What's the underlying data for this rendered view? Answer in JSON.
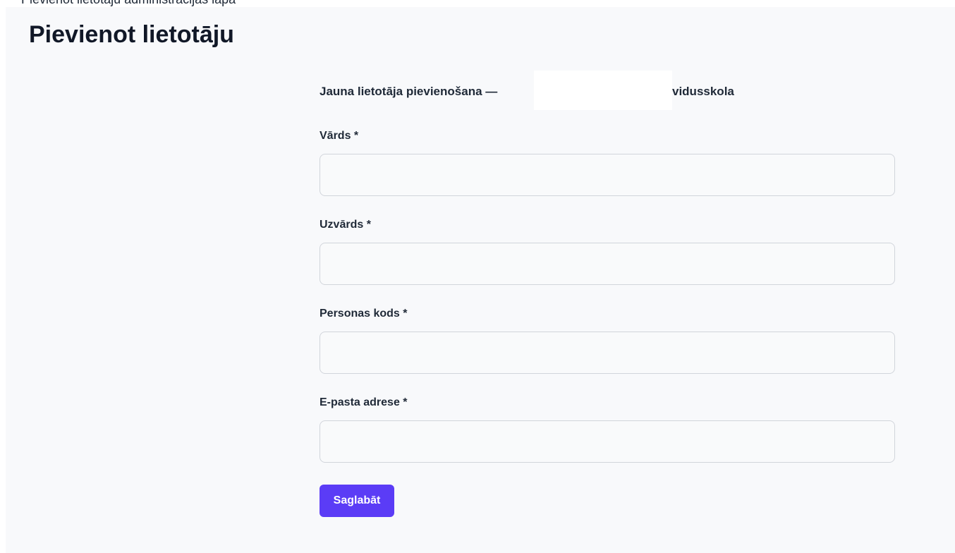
{
  "page": {
    "cropped_top_text": "Pievienot lietotāju administrācijas lapā",
    "title": "Pievienot lietotāju"
  },
  "form": {
    "intro_prefix": "Jauna lietotāja pievienošana —",
    "intro_suffix": "vidusskola",
    "fields": [
      {
        "label": "Vārds *",
        "value": "",
        "placeholder": ""
      },
      {
        "label": "Uzvārds *",
        "value": "",
        "placeholder": ""
      },
      {
        "label": "Personas kods *",
        "value": "",
        "placeholder": ""
      },
      {
        "label": "E-pasta adrese *",
        "value": "",
        "placeholder": ""
      }
    ],
    "save_label": "Saglabāt"
  },
  "colors": {
    "background": "#f8f9fb",
    "accent": "#5b3cf6",
    "input_border": "#d1d5db",
    "text": "#1f2937"
  }
}
